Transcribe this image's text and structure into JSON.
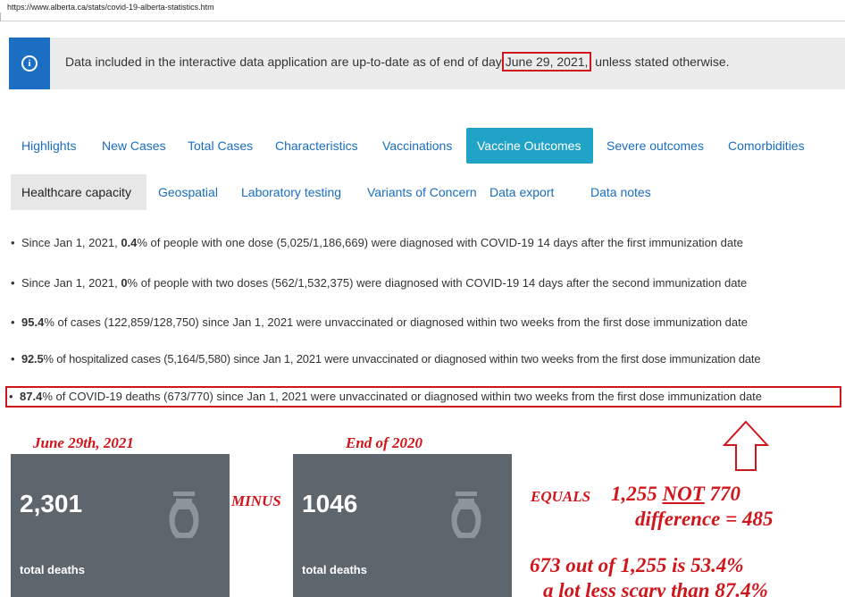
{
  "url": "https://www.alberta.ca/stats/covid-19-alberta-statistics.htm",
  "notice": {
    "icon": "info-icon",
    "text_before": "Data included in the interactive data application are up-to-date as of end of day",
    "date": "June 29, 2021,",
    "text_after": " unless stated otherwise."
  },
  "tabs_row1": [
    {
      "label": "Highlights",
      "active": false
    },
    {
      "label": "New Cases",
      "active": false
    },
    {
      "label": "Total Cases",
      "active": false
    },
    {
      "label": "Characteristics",
      "active": false
    },
    {
      "label": "Vaccinations",
      "active": false
    },
    {
      "label": "Vaccine Outcomes",
      "active": true
    },
    {
      "label": "Severe outcomes",
      "active": false
    },
    {
      "label": "Comorbidities",
      "active": false
    }
  ],
  "tabs_row2": [
    {
      "label": "Healthcare capacity",
      "active": false
    },
    {
      "label": "Geospatial",
      "active": false
    },
    {
      "label": "Laboratory testing",
      "active": false
    },
    {
      "label": "Variants of Concern",
      "active": false
    },
    {
      "label": "Data export",
      "active": false
    },
    {
      "label": "Data notes",
      "active": false
    }
  ],
  "bullets": [
    {
      "pre": "Since Jan 1, 2021, ",
      "bold": "0.4",
      "post": "% of people with one dose (5,025/1,186,669) were diagnosed with COVID-19 14 days after the first immunization date"
    },
    {
      "pre": "Since Jan 1, 2021, ",
      "bold": "0",
      "post": "% of people with two doses (562/1,532,375) were diagnosed with COVID-19 14 days after the second immunization date"
    },
    {
      "pre": "",
      "bold": "95.4",
      "post": "% of cases (122,859/128,750) since Jan 1, 2021 were unvaccinated or diagnosed within two weeks from the first dose immunization date"
    },
    {
      "pre": "",
      "bold": "92.5",
      "post": "% of hospitalized cases (5,164/5,580) since Jan 1, 2021 were unvaccinated or diagnosed within two weeks from the first dose immunization date"
    },
    {
      "pre": "",
      "bold": "87.4",
      "post": "% of COVID-19 deaths (673/770) since Jan 1, 2021 were unvaccinated or diagnosed within two weeks from the first dose immunization date"
    }
  ],
  "cards": [
    {
      "heading": "June 29th, 2021",
      "value": "2,301",
      "label": "total deaths",
      "icon": "urn-icon"
    },
    {
      "heading": "End of 2020",
      "value": "1046",
      "label": "total deaths",
      "icon": "urn-icon"
    }
  ],
  "annotations": {
    "minus": "MINUS",
    "equals": "EQUALS",
    "result_value": "1,255",
    "result_not": "NOT",
    "result_compare": "770",
    "difference": "difference = 485",
    "ratio": "673 out of 1,255 is 53.4%",
    "comment": "a lot less scary than 87.4%"
  },
  "colors": {
    "info_blue": "#1b6ec2",
    "tab_active": "#21a3c7",
    "link_blue": "#1a6dbe",
    "annotation_red": "#d0151b",
    "card_grey": "#5d656d"
  }
}
